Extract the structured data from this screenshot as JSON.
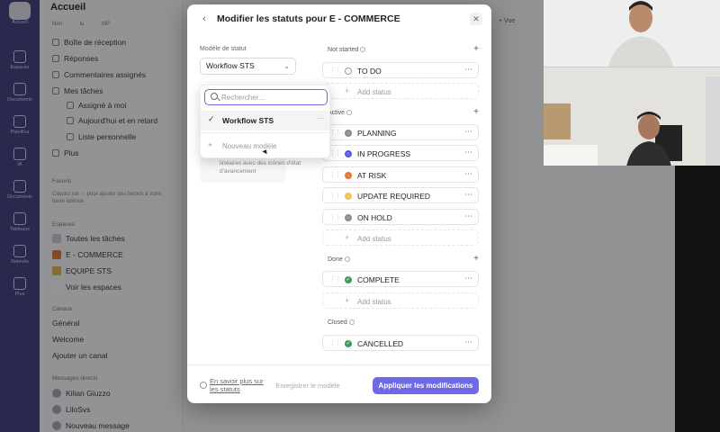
{
  "background": {
    "rail": {
      "items": [
        {
          "label": "Accueil",
          "icon": "home-icon"
        },
        {
          "label": "Espaces",
          "icon": "spaces-icon"
        },
        {
          "label": "Documents",
          "icon": "docs-icon"
        },
        {
          "label": "Planifica",
          "icon": "planner-icon"
        },
        {
          "label": "IA",
          "icon": "ai-icon"
        },
        {
          "label": "Documents",
          "icon": "docs-icon"
        },
        {
          "label": "Tableaux",
          "icon": "boards-icon"
        },
        {
          "label": "Relevés",
          "icon": "timesheet-icon"
        },
        {
          "label": "Plus",
          "icon": "more-icon"
        }
      ]
    },
    "sidebar": {
      "title": "Accueil",
      "subtitle": "Non lu  MP",
      "items": [
        "Boîte de réception",
        "Réponses",
        "Commentaires assignés",
        "Mes tâches",
        "Assigné à moi",
        "Aujourd'hui et en retard",
        "Liste personnelle",
        "Plus"
      ],
      "favorites_head": "Favoris",
      "favorites_desc": "Cliquez sur ☆ pour ajouter des favoris à votre barre latérale",
      "spaces_head": "Espaces",
      "spaces": [
        {
          "label": "Toutes les tâches",
          "color": "#c9c9cf"
        },
        {
          "label": "E - COMMERCE",
          "color": "#e0772e"
        },
        {
          "label": "EQUIPE STS",
          "color": "#e8b34a"
        },
        {
          "label": "Voir les espaces",
          "color": "#ffffff"
        }
      ],
      "channels_head": "Canaux",
      "channels": [
        "Général",
        "Welcome",
        "Ajouter un canal"
      ],
      "dm_head": "Messages directs",
      "dms": [
        "Kilian Giuzzo",
        "LiloSvs",
        "Nouveau message"
      ]
    }
  },
  "modal": {
    "title": "Modifier les statuts pour E - COMMERCE",
    "model_label": "Modèle de statut",
    "model_value": "Workflow STS",
    "desc_text": "linéaires avec des icônes d'état d'avancement",
    "dropdown": {
      "search_placeholder": "Rechercher...",
      "option_selected": "Workflow STS",
      "option_new": "Nouveau modèle"
    },
    "groups": [
      {
        "name": "Not started",
        "statuses": [
          {
            "label": "TO DO",
            "color": "#9a9aa0",
            "style": "outline"
          }
        ],
        "add_label": "Add status"
      },
      {
        "name": "Active",
        "statuses": [
          {
            "label": "PLANNING",
            "color": "#8a8a92",
            "style": "dot"
          },
          {
            "label": "IN PROGRESS",
            "color": "#5b57e0",
            "style": "dot"
          },
          {
            "label": "AT RISK",
            "color": "#e0772e",
            "style": "dot"
          },
          {
            "label": "UPDATE REQUIRED",
            "color": "#f0c15a",
            "style": "dot"
          },
          {
            "label": "ON HOLD",
            "color": "#8a8a92",
            "style": "dot"
          }
        ],
        "add_label": "Add status"
      },
      {
        "name": "Done",
        "statuses": [
          {
            "label": "COMPLETE",
            "color": "#3e9b5e",
            "style": "check"
          }
        ],
        "add_label": "Add status"
      },
      {
        "name": "Closed",
        "statuses": [
          {
            "label": "CANCELLED",
            "color": "#3e9b5e",
            "style": "check"
          }
        ]
      }
    ],
    "footer": {
      "learn_more": "En savoir plus sur les statuts",
      "save_model": "Enregistrer le modèle",
      "apply": "Appliquer les modifications"
    },
    "accent": "#6e6ae6"
  }
}
